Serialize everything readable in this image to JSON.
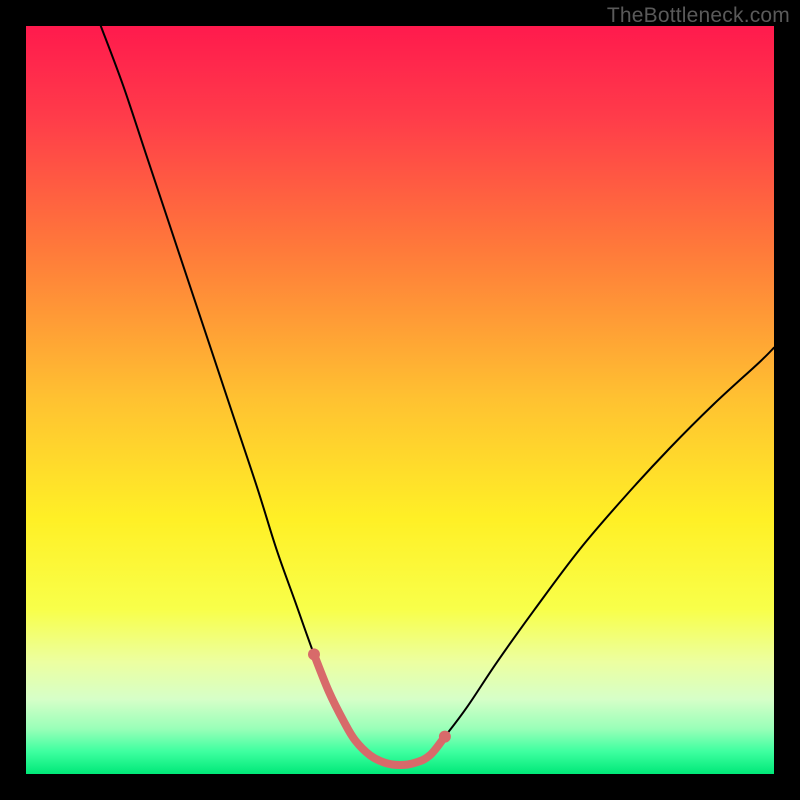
{
  "watermark": {
    "text": "TheBottleneck.com"
  },
  "chart_data": {
    "type": "line",
    "title": "",
    "xlabel": "",
    "ylabel": "",
    "xlim": [
      0,
      100
    ],
    "ylim": [
      0,
      100
    ],
    "gradient_stops": [
      {
        "offset": 0.0,
        "color": "#ff1a4d"
      },
      {
        "offset": 0.12,
        "color": "#ff3b4a"
      },
      {
        "offset": 0.3,
        "color": "#ff7a3a"
      },
      {
        "offset": 0.5,
        "color": "#ffc231"
      },
      {
        "offset": 0.66,
        "color": "#fff026"
      },
      {
        "offset": 0.78,
        "color": "#f8ff4a"
      },
      {
        "offset": 0.85,
        "color": "#ecffa0"
      },
      {
        "offset": 0.9,
        "color": "#d6ffc8"
      },
      {
        "offset": 0.94,
        "color": "#98ffb8"
      },
      {
        "offset": 0.97,
        "color": "#3effa0"
      },
      {
        "offset": 1.0,
        "color": "#00e878"
      }
    ],
    "series": [
      {
        "name": "main-curve",
        "color": "#000000",
        "width": 2,
        "x": [
          10,
          13,
          16,
          19,
          22,
          25,
          28,
          31,
          33.5,
          36,
          38.5,
          40.5,
          42.5,
          44,
          46,
          48,
          50,
          52,
          54,
          56,
          59,
          63,
          68,
          74,
          80,
          86,
          92,
          98,
          100
        ],
        "y": [
          100,
          92,
          83,
          74,
          65,
          56,
          47,
          38,
          30,
          23,
          16,
          11,
          7,
          4.5,
          2.5,
          1.5,
          1.2,
          1.5,
          2.5,
          5,
          9,
          15,
          22,
          30,
          37,
          43.5,
          49.5,
          55,
          57
        ]
      },
      {
        "name": "bottom-highlight",
        "color": "#d86a6a",
        "width": 8,
        "x": [
          38.5,
          40.5,
          42.5,
          44,
          46,
          48,
          50,
          52,
          54,
          56
        ],
        "y": [
          16,
          11,
          7,
          4.5,
          2.5,
          1.5,
          1.2,
          1.5,
          2.5,
          5
        ]
      }
    ]
  }
}
